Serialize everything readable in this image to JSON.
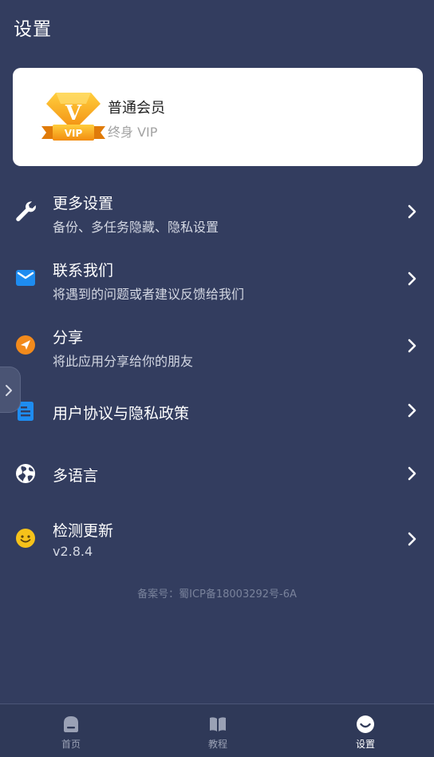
{
  "page": {
    "title": "设置"
  },
  "member": {
    "level": "普通会员",
    "duration": "终身 VIP",
    "badge_text": "VIP"
  },
  "menu": {
    "items": [
      {
        "key": "more-settings",
        "title": "更多设置",
        "subtitle": "备份、多任务隐藏、隐私设置",
        "icon": "wrench-icon"
      },
      {
        "key": "contact-us",
        "title": "联系我们",
        "subtitle": "将遇到的问题或者建议反馈给我们",
        "icon": "mail-icon"
      },
      {
        "key": "share",
        "title": "分享",
        "subtitle": "将此应用分享给你的朋友",
        "icon": "send-icon"
      },
      {
        "key": "user-agreement",
        "title": "用户协议与隐私政策",
        "subtitle": "",
        "icon": "document-icon"
      },
      {
        "key": "language",
        "title": "多语言",
        "subtitle": "",
        "icon": "globe-icon"
      },
      {
        "key": "check-update",
        "title": "检测更新",
        "subtitle": "v2.8.4",
        "icon": "smiley-icon"
      }
    ]
  },
  "footer": {
    "record_no": "备案号：蜀ICP备18003292号-6A"
  },
  "bottom_nav": {
    "items": [
      {
        "label": "首页",
        "icon": "home-icon",
        "active": false
      },
      {
        "label": "教程",
        "icon": "book-icon",
        "active": false
      },
      {
        "label": "设置",
        "icon": "settings-smile-icon",
        "active": true
      }
    ]
  },
  "colors": {
    "background": "#333d5f",
    "card": "#ffffff",
    "mail_blue": "#1e8cf0",
    "share_orange": "#f28a1c",
    "doc_blue": "#1e8cf0",
    "smiley_yellow": "#f6c21a",
    "vip_gold": "#f5a51c",
    "nav_inactive": "#9aa1b5",
    "nav_active": "#ffffff"
  }
}
